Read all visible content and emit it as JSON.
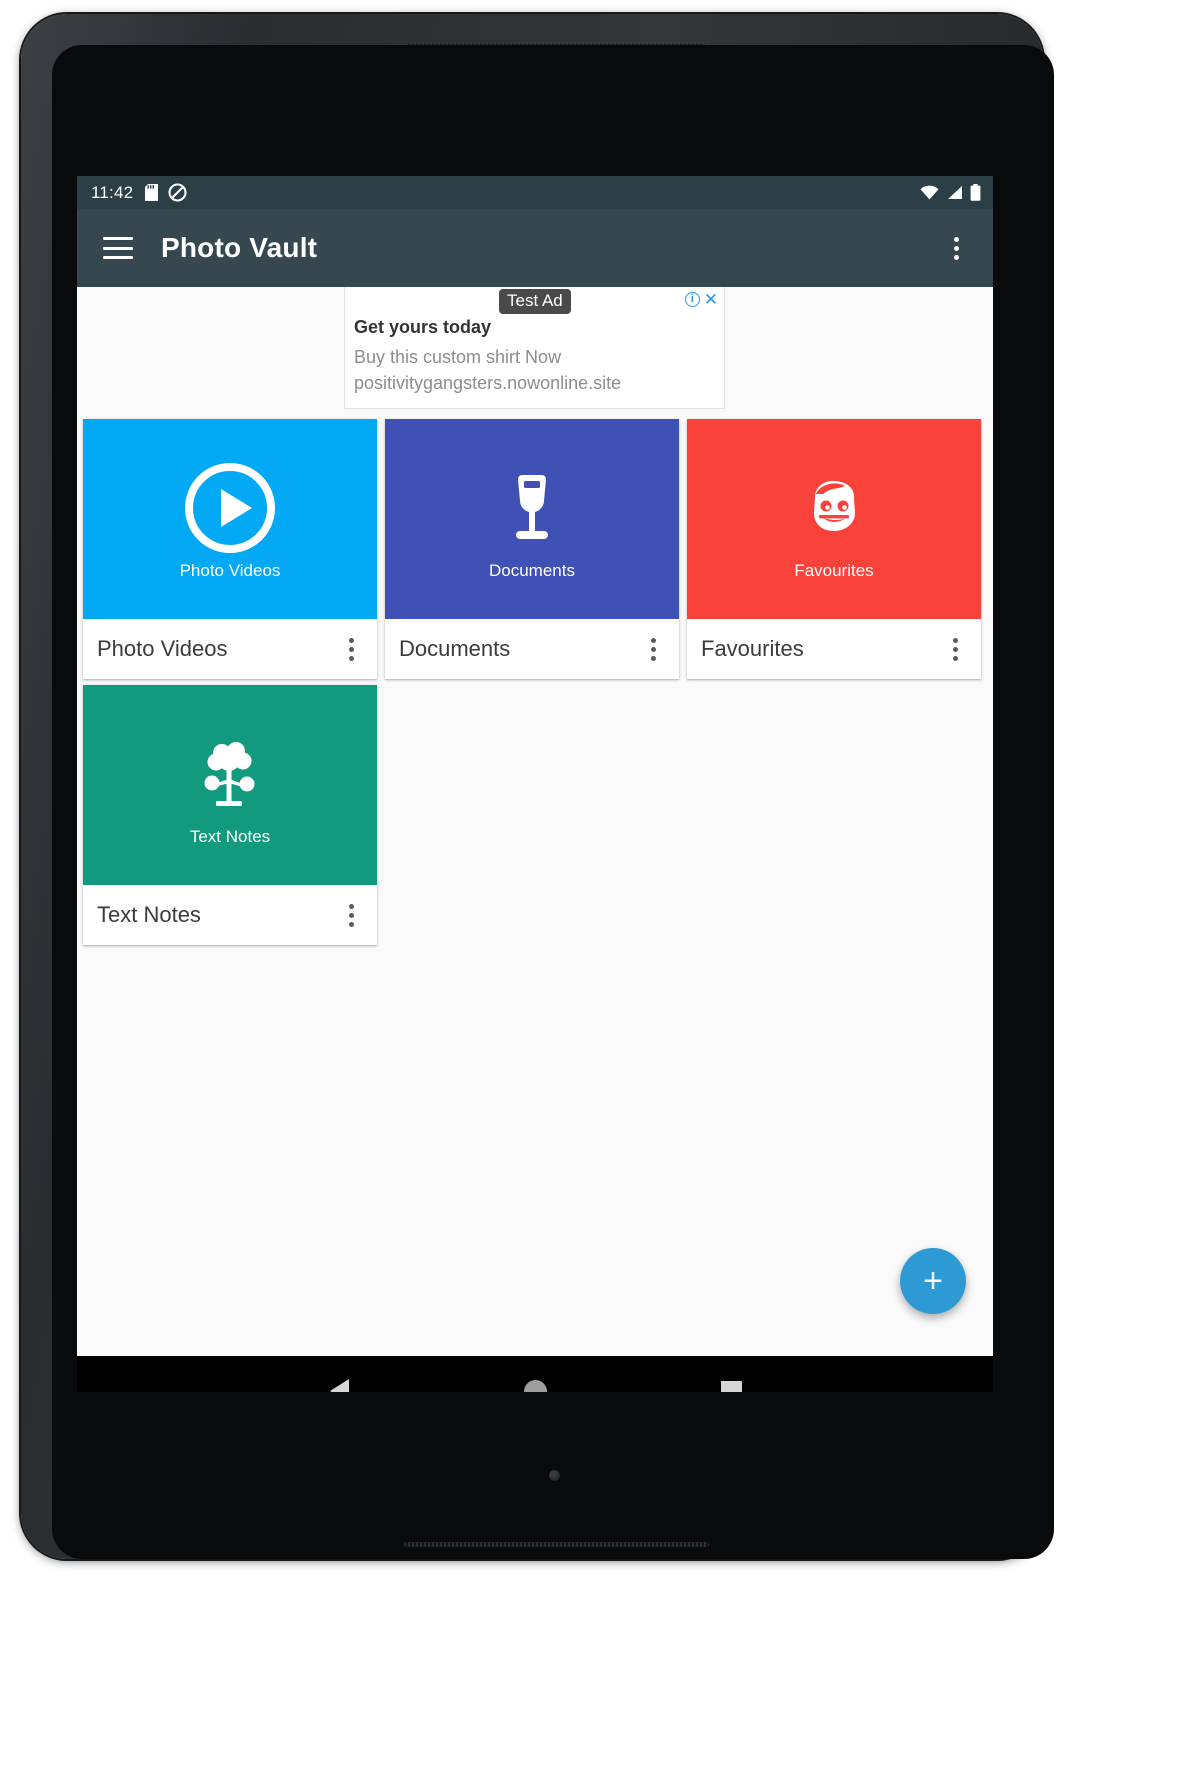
{
  "status_bar": {
    "time": "11:42",
    "left_icons": [
      "sd-card-icon",
      "do-not-disturb-icon"
    ],
    "right_icons": [
      "wifi-icon",
      "cellular-signal-icon",
      "battery-icon"
    ],
    "background_color": "#2c3e46"
  },
  "app_bar": {
    "menu_icon": "hamburger-menu-icon",
    "title": "Photo Vault",
    "overflow_icon": "overflow-menu-icon",
    "background_color": "#37474f"
  },
  "ad": {
    "badge": "Test Ad",
    "info_glyph": "i",
    "close_glyph": "✕",
    "headline": "Get yours today",
    "body_line1": "Buy this custom shirt Now",
    "body_line2": "positivitygangsters.nowonline.site",
    "accent_color": "#2196f3"
  },
  "folders": [
    {
      "name": "Photo Videos",
      "thumb_label": "Photo Videos",
      "color": "#03a9f4",
      "icon": "play-circle-icon",
      "menu_icon": "overflow-menu-icon"
    },
    {
      "name": "Documents",
      "thumb_label": "Documents",
      "color": "#3f51b5",
      "icon": "goblet-icon",
      "menu_icon": "overflow-menu-icon"
    },
    {
      "name": "Favourites",
      "thumb_label": "Favourites",
      "color": "#f9423a",
      "icon": "face-emoji-icon",
      "menu_icon": "overflow-menu-icon"
    },
    {
      "name": "Text Notes",
      "thumb_label": "Text Notes",
      "color": "#119a7e",
      "icon": "tree-icon",
      "menu_icon": "overflow-menu-icon"
    }
  ],
  "fab": {
    "label": "+",
    "name": "add-folder-fab",
    "color": "#2d9ad6"
  },
  "nav_bar": {
    "back": "back-nav-icon",
    "home": "home-nav-icon",
    "recents": "recents-nav-icon"
  }
}
